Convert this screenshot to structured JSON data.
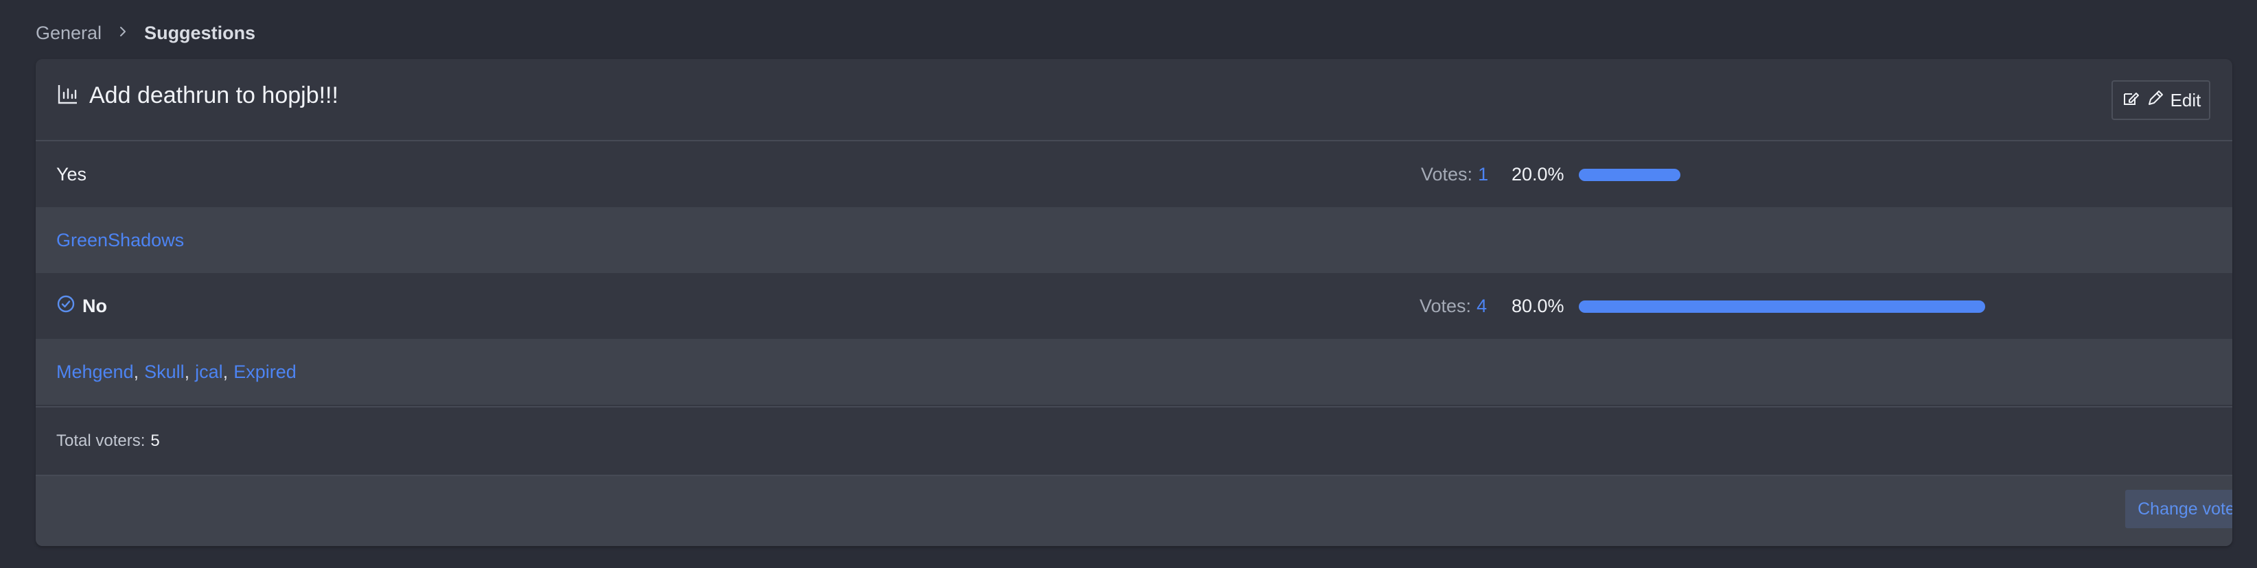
{
  "breadcrumb": {
    "root": "General",
    "current": "Suggestions"
  },
  "poll": {
    "title": "Add deathrun to hopjb!!!",
    "edit_label": "Edit",
    "options": [
      {
        "label": "Yes",
        "votes_label": "Votes:",
        "votes": "1",
        "percent_text": "20.0%",
        "percent": 20,
        "selected": false,
        "voters": [
          "GreenShadows"
        ]
      },
      {
        "label": "No",
        "votes_label": "Votes:",
        "votes": "4",
        "percent_text": "80.0%",
        "percent": 80,
        "selected": true,
        "voters": [
          "Mehgend",
          "Skull",
          "jcal",
          "Expired"
        ]
      }
    ],
    "total_voters_label": "Total voters:",
    "total_voters": "5",
    "change_vote_label": "Change vote"
  },
  "colors": {
    "accent": "#5086f5",
    "link": "#4d84f3",
    "card": "#343741",
    "background": "#2a2d37"
  },
  "icons": {
    "title_icon": "bar-chart-icon",
    "edit_icons": [
      "edit-square-icon",
      "pencil-icon"
    ],
    "selected_icon": "check-circle-icon",
    "breadcrumb_separator": "chevron-right-icon"
  }
}
